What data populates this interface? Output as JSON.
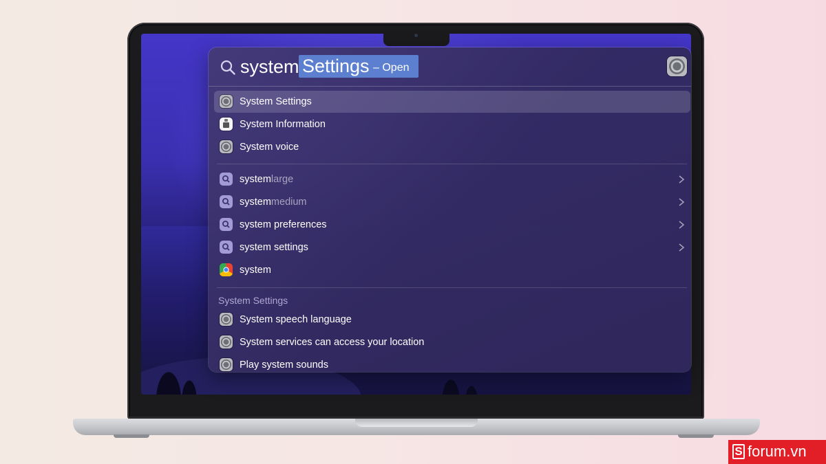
{
  "spotlight": {
    "query": "system",
    "suggestion": "Settings",
    "suggestion_action": "– Open",
    "top_app_icon": "system-settings-icon"
  },
  "results": [
    {
      "label": "System Settings",
      "icon": "system-settings-icon",
      "selected": true
    },
    {
      "label": "System Information",
      "icon": "system-information-icon"
    },
    {
      "label": "System voice",
      "icon": "system-settings-icon"
    }
  ],
  "suggestions": [
    {
      "bold": "system",
      "rest": "large",
      "icon": "search-icon",
      "chevron": true
    },
    {
      "bold": "system",
      "rest": "medium",
      "icon": "search-icon",
      "chevron": true
    },
    {
      "bold": "system preferences",
      "rest": "",
      "icon": "search-icon",
      "chevron": true
    },
    {
      "bold": "system settings",
      "rest": "",
      "icon": "search-icon",
      "chevron": true
    },
    {
      "bold": "system",
      "rest": "",
      "icon": "chrome-icon",
      "chevron": false
    }
  ],
  "section": {
    "title": "System Settings",
    "items": [
      {
        "label": "System speech language",
        "icon": "system-settings-icon"
      },
      {
        "label": "System services can access your location",
        "icon": "system-settings-icon"
      },
      {
        "label": "Play system sounds",
        "icon": "system-settings-icon"
      }
    ]
  },
  "watermark": {
    "box": "S",
    "text": "forum.vn"
  },
  "colors": {
    "highlight": "#5d7fd0",
    "watermark": "#e21e26",
    "panel": "#3a3170"
  }
}
